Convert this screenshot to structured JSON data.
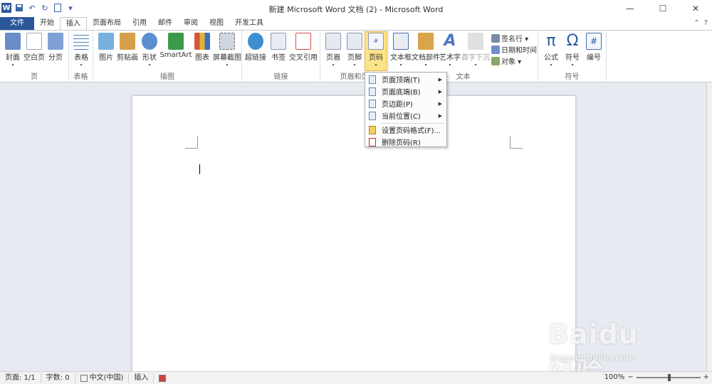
{
  "window": {
    "title": "新建 Microsoft Word 文档 (2) - Microsoft Word",
    "controls": [
      "—",
      "☐",
      "✕"
    ]
  },
  "quick_access": {
    "app_icon": "W",
    "save": "💾",
    "undo": "↶",
    "redo": "↻",
    "new": "▫",
    "customize": "▾"
  },
  "tabs": [
    {
      "label": "文件"
    },
    {
      "label": "开始"
    },
    {
      "label": "插入"
    },
    {
      "label": "页面布局"
    },
    {
      "label": "引用"
    },
    {
      "label": "邮件"
    },
    {
      "label": "审阅"
    },
    {
      "label": "视图"
    },
    {
      "label": "开发工具"
    }
  ],
  "tabbar_right": {
    "minimize": "⌃",
    "help": "?"
  },
  "ribbon": {
    "groups": {
      "page": {
        "label": "页",
        "buttons": [
          {
            "label": "封面",
            "color": "#6a8cc7"
          },
          {
            "label": "空白页",
            "color": "#ffffff"
          },
          {
            "label": "分页",
            "color": "#7fa1d6"
          }
        ]
      },
      "table": {
        "label": "表格",
        "buttons": [
          {
            "label": "表格",
            "color": "#4f7dc2"
          }
        ]
      },
      "illustrations": {
        "label": "插图",
        "buttons": [
          {
            "label": "图片",
            "color": "#7ab0e0"
          },
          {
            "label": "剪贴画",
            "color": "#d6a04a"
          },
          {
            "label": "形状",
            "color": "#5b8fd0"
          },
          {
            "label": "SmartArt",
            "color": "#3a9a4a"
          },
          {
            "label": "图表",
            "color": "#d05a3a"
          },
          {
            "label": "屏幕截图",
            "color": "#cfd6e0"
          }
        ]
      },
      "links": {
        "label": "链接",
        "buttons": [
          {
            "label": "超链接",
            "color": "#3f8fd0"
          },
          {
            "label": "书签",
            "color": "#e9edf3"
          },
          {
            "label": "交叉引用",
            "color": "#d65050"
          }
        ]
      },
      "header_footer": {
        "label": "页眉和页",
        "buttons": [
          {
            "label": "页眉",
            "color": "#e6e9ef"
          },
          {
            "label": "页脚",
            "color": "#e6e9ef"
          },
          {
            "label": "页码",
            "color": "#f3f6fb"
          }
        ]
      },
      "text": {
        "label": "文本",
        "buttons": [
          {
            "label": "文本框",
            "color": "#e9edf3"
          },
          {
            "label": "文档部件",
            "color": "#d9a54a"
          },
          {
            "label": "艺术字",
            "color": "#4a74c0"
          },
          {
            "label": "首字下沉",
            "color": "#e0e0e0"
          }
        ],
        "small": [
          {
            "label": "签名行 ▾",
            "color": "#7b8ba5"
          },
          {
            "label": "日期和时间",
            "color": "#6e8fc8"
          },
          {
            "label": "对象 ▾",
            "color": "#8aa66a"
          }
        ]
      },
      "symbols": {
        "label": "符号",
        "buttons": [
          {
            "label": "公式",
            "glyph": "π"
          },
          {
            "label": "符号",
            "glyph": "Ω"
          },
          {
            "label": "编号",
            "glyph": "#"
          }
        ]
      }
    }
  },
  "page_number_menu": {
    "items": [
      {
        "label": "页面顶端(T)",
        "has_submenu": true
      },
      {
        "label": "页面底端(B)",
        "has_submenu": true
      },
      {
        "label": "页边距(P)",
        "has_submenu": true
      },
      {
        "label": "当前位置(C)",
        "has_submenu": true
      },
      {
        "label": "设置页码格式(F)...",
        "has_submenu": false
      },
      {
        "label": "删除页码(R)",
        "has_submenu": false
      }
    ],
    "submenu_arrow": "▶"
  },
  "status_bar": {
    "page": "页面: 1/1",
    "words": "字数: 0",
    "language": "中文(中国)",
    "mode": "插入",
    "zoom": "100%",
    "zoom_minus": "−",
    "zoom_plus": "+"
  },
  "watermark": {
    "main": "Baidu 经验",
    "sub": "jingyan.baidu.com"
  }
}
